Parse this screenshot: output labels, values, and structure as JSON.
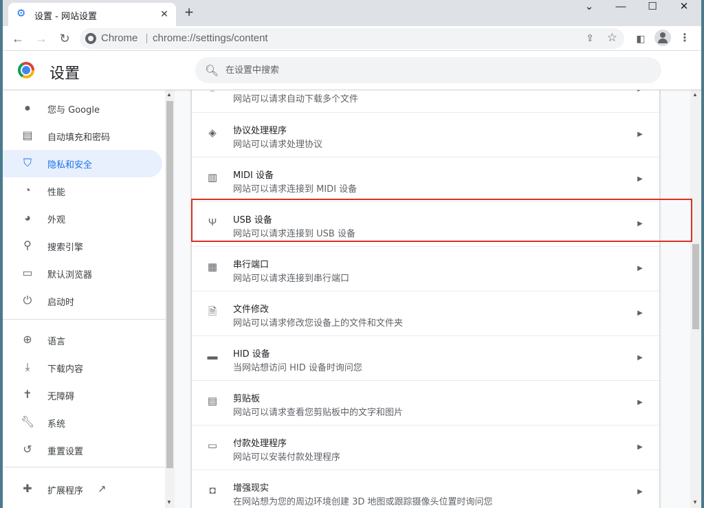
{
  "tab": {
    "title": "设置 - 网站设置",
    "favicon": "gear-icon"
  },
  "omnibox": {
    "chip": "Chrome",
    "url": "chrome://settings/content"
  },
  "settings": {
    "title": "设置",
    "search_placeholder": "在设置中搜索"
  },
  "sidebar": {
    "items": [
      {
        "label": "您与 Google",
        "icon": "person-icon",
        "active": false
      },
      {
        "label": "自动填充和密码",
        "icon": "clipboard-icon",
        "active": false
      },
      {
        "label": "隐私和安全",
        "icon": "shield-icon",
        "active": true
      },
      {
        "label": "性能",
        "icon": "gauge-icon",
        "active": false
      },
      {
        "label": "外观",
        "icon": "palette-icon",
        "active": false
      },
      {
        "label": "搜索引擎",
        "icon": "search-icon",
        "active": false
      },
      {
        "label": "默认浏览器",
        "icon": "browser-window-icon",
        "active": false
      },
      {
        "label": "启动时",
        "icon": "power-icon",
        "active": false
      },
      {
        "label": "语言",
        "icon": "globe-icon",
        "active": false
      },
      {
        "label": "下载内容",
        "icon": "download-icon",
        "active": false
      },
      {
        "label": "无障碍",
        "icon": "accessibility-icon",
        "active": false
      },
      {
        "label": "系统",
        "icon": "wrench-icon",
        "active": false
      },
      {
        "label": "重置设置",
        "icon": "history-icon",
        "active": false
      },
      {
        "label": "扩展程序",
        "icon": "puzzle-icon",
        "active": false
      }
    ]
  },
  "content": {
    "rows": [
      {
        "title": "",
        "subtitle": "网站可以请求自动下载多个文件",
        "icon": "download-icon"
      },
      {
        "title": "协议处理程序",
        "subtitle": "网站可以请求处理协议",
        "icon": "protocol-diamond-icon"
      },
      {
        "title": "MIDI 设备",
        "subtitle": "网站可以请求连接到 MIDI 设备",
        "icon": "piano-icon"
      },
      {
        "title": "USB 设备",
        "subtitle": "网站可以请求连接到 USB 设备",
        "icon": "usb-icon"
      },
      {
        "title": "串行端口",
        "subtitle": "网站可以请求连接到串行端口",
        "icon": "serial-port-icon"
      },
      {
        "title": "文件修改",
        "subtitle": "网站可以请求修改您设备上的文件和文件夹",
        "icon": "file-edit-icon"
      },
      {
        "title": "HID 设备",
        "subtitle": "当网站想访问 HID 设备时询问您",
        "icon": "gamepad-icon"
      },
      {
        "title": "剪贴板",
        "subtitle": "网站可以请求查看您剪贴板中的文字和图片",
        "icon": "clipboard-icon"
      },
      {
        "title": "付款处理程序",
        "subtitle": "网站可以安装付款处理程序",
        "icon": "credit-card-icon"
      },
      {
        "title": "增强现实",
        "subtitle": "在网站想为您的周边环境创建 3D 地图或跟踪摄像头位置时询问您",
        "icon": "vr-headset-icon"
      }
    ]
  },
  "colors": {
    "accent": "#1a73e8",
    "highlight": "#d93025",
    "active_bg": "#e8f0fe"
  }
}
